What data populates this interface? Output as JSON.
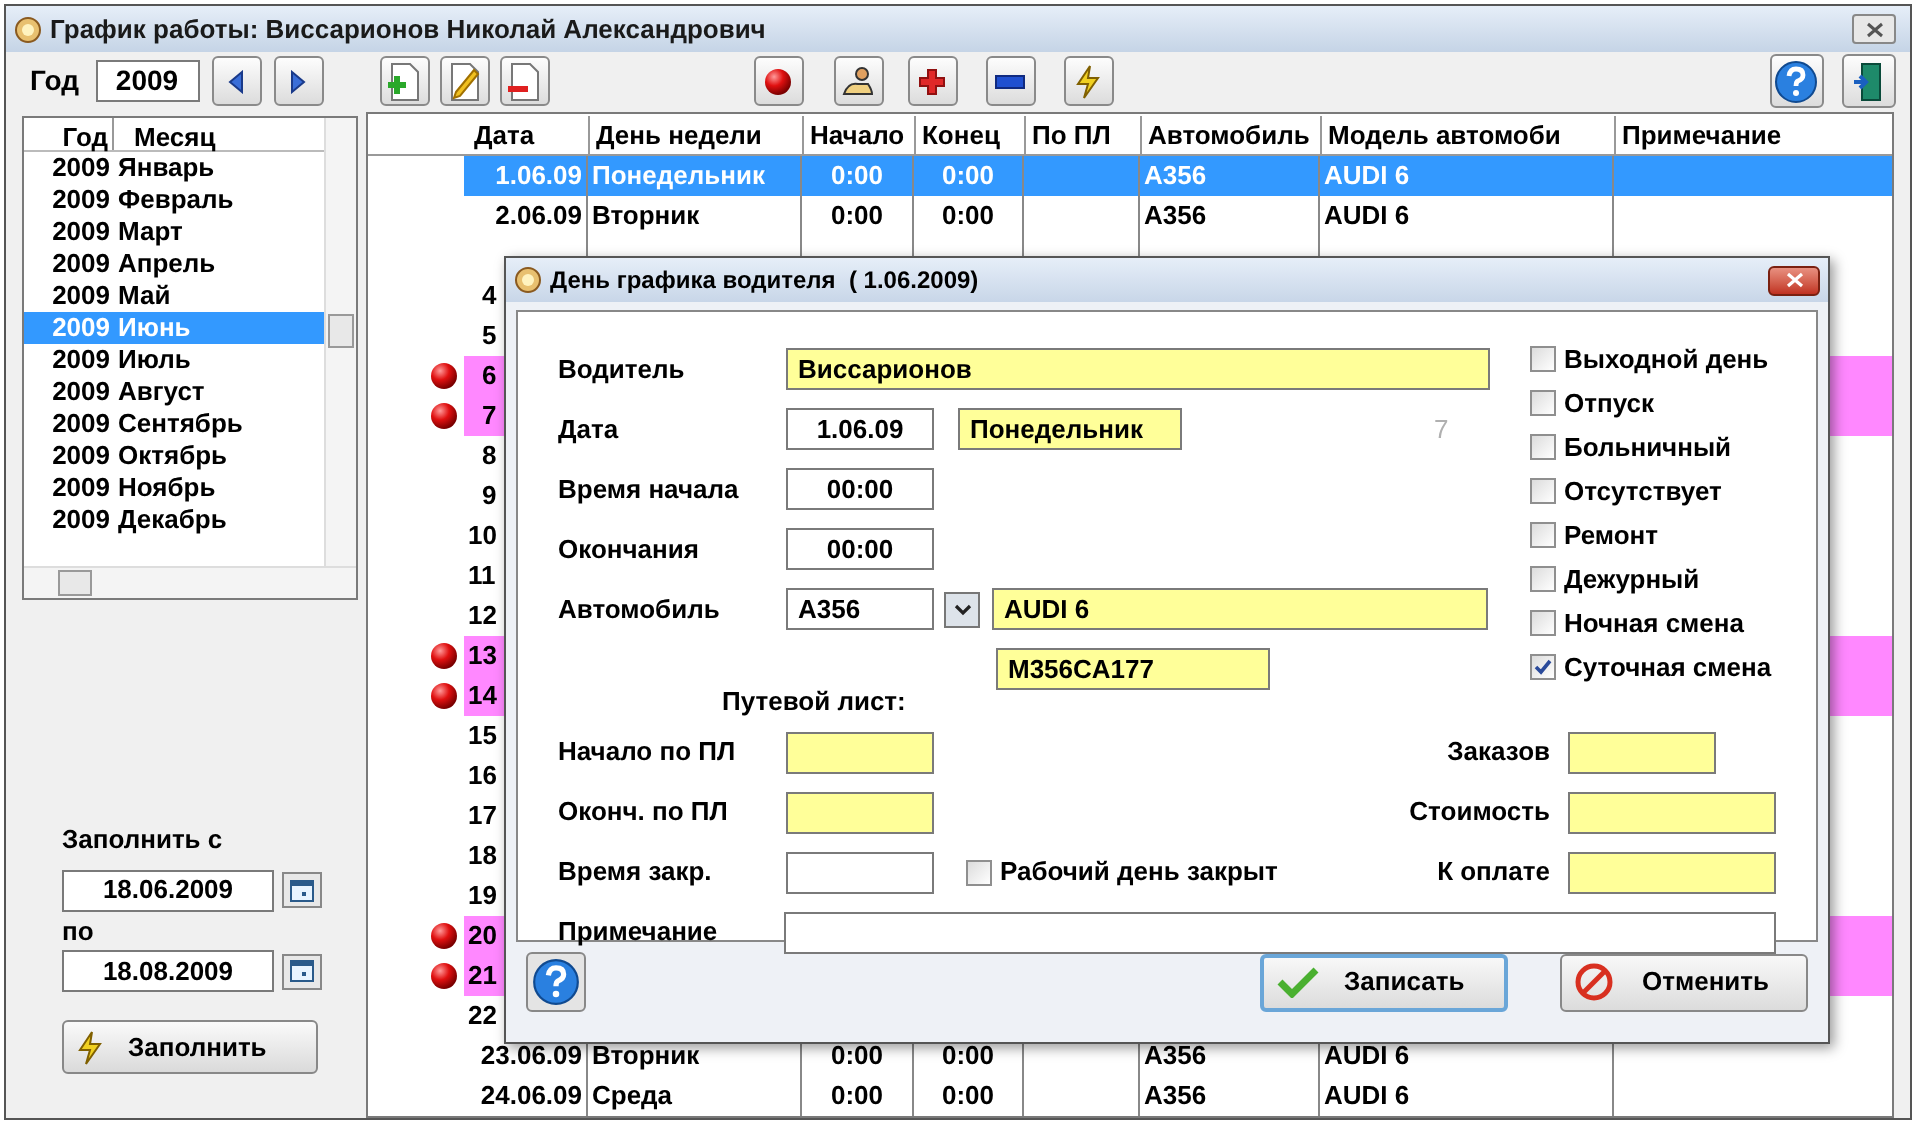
{
  "window": {
    "title": "График работы: Виссарионов Николай Александрович"
  },
  "toolbar": {
    "year_label": "Год",
    "year": "2009"
  },
  "months": {
    "columns": [
      "Год",
      "Месяц"
    ],
    "rows": [
      {
        "year": "2009",
        "month": "Январь",
        "selected": false
      },
      {
        "year": "2009",
        "month": "Февраль",
        "selected": false
      },
      {
        "year": "2009",
        "month": "Март",
        "selected": false
      },
      {
        "year": "2009",
        "month": "Апрель",
        "selected": false
      },
      {
        "year": "2009",
        "month": "Май",
        "selected": false
      },
      {
        "year": "2009",
        "month": "Июнь",
        "selected": true
      },
      {
        "year": "2009",
        "month": "Июль",
        "selected": false
      },
      {
        "year": "2009",
        "month": "Август",
        "selected": false
      },
      {
        "year": "2009",
        "month": "Сентябрь",
        "selected": false
      },
      {
        "year": "2009",
        "month": "Октябрь",
        "selected": false
      },
      {
        "year": "2009",
        "month": "Ноябрь",
        "selected": false
      },
      {
        "year": "2009",
        "month": "Декабрь",
        "selected": false
      }
    ]
  },
  "fill": {
    "from_label": "Заполнить с",
    "from": "18.06.2009",
    "to_label": "по",
    "to": "18.08.2009",
    "button": "Заполнить"
  },
  "table": {
    "columns": [
      "Дата",
      "День недели",
      "Начало",
      "Конец",
      "По ПЛ",
      "Автомобиль",
      "Модель автомоби",
      "Примечание"
    ],
    "rows": [
      {
        "cells": [
          "1.06.09",
          "Понедельник",
          "0:00",
          "0:00",
          "",
          "A356",
          "AUDI 6",
          ""
        ],
        "selected": true,
        "weekend": false
      },
      {
        "cells": [
          "2.06.09",
          "Вторник",
          "0:00",
          "0:00",
          "",
          "A356",
          "AUDI 6",
          ""
        ],
        "selected": false,
        "weekend": false
      },
      {
        "selected": false,
        "weekend": false
      },
      {
        "cells": [
          "4"
        ],
        "selected": false,
        "weekend": false
      },
      {
        "cells": [
          "5"
        ],
        "selected": false,
        "weekend": false
      },
      {
        "cells": [
          "6"
        ],
        "selected": false,
        "weekend": true
      },
      {
        "cells": [
          "7"
        ],
        "selected": false,
        "weekend": true
      },
      {
        "cells": [
          "8"
        ],
        "selected": false,
        "weekend": false
      },
      {
        "cells": [
          "9"
        ],
        "selected": false,
        "weekend": false
      },
      {
        "cells": [
          "10"
        ],
        "selected": false,
        "weekend": false
      },
      {
        "cells": [
          "11"
        ],
        "selected": false,
        "weekend": false
      },
      {
        "cells": [
          "12"
        ],
        "selected": false,
        "weekend": false
      },
      {
        "cells": [
          "13"
        ],
        "selected": false,
        "weekend": true
      },
      {
        "cells": [
          "14"
        ],
        "selected": false,
        "weekend": true
      },
      {
        "cells": [
          "15"
        ],
        "selected": false,
        "weekend": false
      },
      {
        "cells": [
          "16"
        ],
        "selected": false,
        "weekend": false
      },
      {
        "cells": [
          "17"
        ],
        "selected": false,
        "weekend": false
      },
      {
        "cells": [
          "18"
        ],
        "selected": false,
        "weekend": false
      },
      {
        "cells": [
          "19"
        ],
        "selected": false,
        "weekend": false
      },
      {
        "cells": [
          "20"
        ],
        "selected": false,
        "weekend": true
      },
      {
        "cells": [
          "21"
        ],
        "selected": false,
        "weekend": true
      },
      {
        "cells": [
          "22"
        ],
        "selected": false,
        "weekend": false
      },
      {
        "cells": [
          "23.06.09",
          "Вторник",
          "0:00",
          "0:00",
          "",
          "A356",
          "AUDI 6",
          ""
        ],
        "selected": false,
        "weekend": false
      },
      {
        "cells": [
          "24.06.09",
          "Среда",
          "0:00",
          "0:00",
          "",
          "A356",
          "AUDI 6",
          ""
        ],
        "selected": false,
        "weekend": false
      }
    ]
  },
  "dialog": {
    "title": "День графика водителя  ( 1.06.2009)",
    "driver_label": "Водитель",
    "driver": "Виссарионов",
    "date_label": "Дата",
    "date": "1.06.09",
    "weekday": "Понедельник",
    "day_number": "7",
    "start_label": "Время начала",
    "start": "00:00",
    "end_label": "Окончания",
    "end": "00:00",
    "car_label": "Автомобиль",
    "car": "A356",
    "car_model": "AUDI 6",
    "plate": "M356CA177",
    "waybill_label": "Путевой лист:",
    "checkboxes": [
      {
        "label": "Выходной день",
        "checked": false
      },
      {
        "label": "Отпуск",
        "checked": false
      },
      {
        "label": "Больничный",
        "checked": false
      },
      {
        "label": "Отсутствует",
        "checked": false
      },
      {
        "label": "Ремонт",
        "checked": false
      },
      {
        "label": "Дежурный",
        "checked": false
      },
      {
        "label": "Ночная смена",
        "checked": false
      },
      {
        "label": "Суточная смена",
        "checked": true
      }
    ],
    "pl_start_label": "Начало по ПЛ",
    "pl_end_label": "Оконч. по ПЛ",
    "close_time_label": "Время закр.",
    "closed": {
      "label": "Рабочий день закрыт",
      "checked": false
    },
    "orders_label": "Заказов",
    "cost_label": "Стоимость",
    "pay_label": "К оплате",
    "note_label": "Примечание",
    "save": "Записать",
    "cancel": "Отменить"
  }
}
